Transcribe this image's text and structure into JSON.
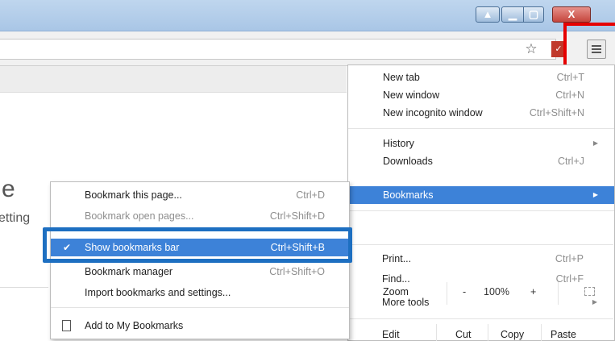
{
  "colors": {
    "titlebar": "#b4cfea",
    "menu_highlight": "#3d82d8",
    "annotation_red": "#e60000",
    "annotation_blue": "#1d6fc1"
  },
  "icons": {
    "star": "star-icon",
    "menu": "hamburger-menu-icon",
    "close": "close-icon",
    "minimize": "minimize-icon",
    "maximize": "maximize-icon",
    "user": "user-icon"
  },
  "page": {
    "letter": "e",
    "settings_fragment": "etting"
  },
  "chrome_menu": {
    "items": [
      {
        "label": "New tab",
        "shortcut": "Ctrl+T"
      },
      {
        "label": "New window",
        "shortcut": "Ctrl+N"
      },
      {
        "label": "New incognito window",
        "shortcut": "Ctrl+Shift+N"
      },
      {
        "label": "History",
        "shortcut": ""
      },
      {
        "label": "Downloads",
        "shortcut": "Ctrl+J"
      },
      {
        "label": "Bookmarks",
        "shortcut": ""
      },
      {
        "label": "Print...",
        "shortcut": "Ctrl+P"
      },
      {
        "label": "Find...",
        "shortcut": "Ctrl+F"
      },
      {
        "label": "More tools",
        "shortcut": ""
      }
    ],
    "zoom": {
      "label": "Zoom",
      "minus": "-",
      "value": "100%",
      "plus": "+"
    },
    "edit": {
      "label": "Edit",
      "cut": "Cut",
      "copy": "Copy",
      "paste": "Paste"
    }
  },
  "bookmarks_menu": {
    "items": [
      {
        "label": "Bookmark this page...",
        "shortcut": "Ctrl+D"
      },
      {
        "label": "Bookmark open pages...",
        "shortcut": "Ctrl+Shift+D"
      },
      {
        "label": "Show bookmarks bar",
        "shortcut": "Ctrl+Shift+B",
        "checked": true
      },
      {
        "label": "Bookmark manager",
        "shortcut": "Ctrl+Shift+O"
      },
      {
        "label": "Import bookmarks and settings...",
        "shortcut": ""
      },
      {
        "label": "Add to My Bookmarks",
        "shortcut": ""
      }
    ]
  }
}
